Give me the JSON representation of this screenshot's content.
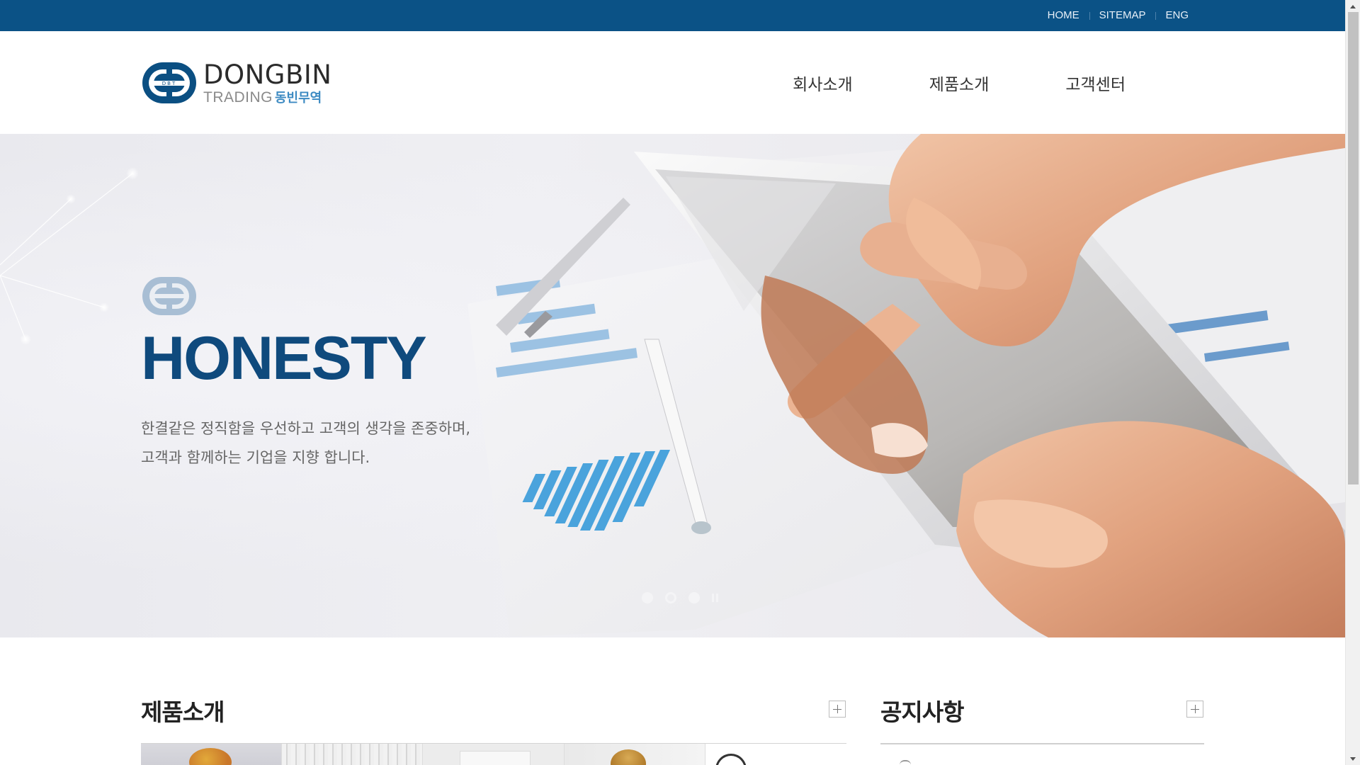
{
  "utility_nav": {
    "items": [
      {
        "label": "HOME"
      },
      {
        "label": "SITEMAP"
      },
      {
        "label": "ENG"
      }
    ]
  },
  "logo": {
    "line1": "DONGBIN",
    "line2_en": "TRADING",
    "line2_ko": "동빈무역",
    "mark_text": "DBT"
  },
  "main_nav": {
    "items": [
      {
        "label": "회사소개"
      },
      {
        "label": "제품소개"
      },
      {
        "label": "고객센터"
      }
    ]
  },
  "hero": {
    "title": "HONESTY",
    "description": [
      "한결같은 정직함을 우선하고 고객의 생각을 존중하며,",
      "고객과 함께하는 기업을 지향 합니다."
    ],
    "slider": {
      "total_slides": 3,
      "active_slide": 2
    }
  },
  "sections": {
    "products": {
      "title": "제품소개"
    },
    "notices": {
      "title": "공지사항"
    }
  },
  "colors": {
    "brand_blue": "#0b5286",
    "headline_blue": "#0f4a7d",
    "logo_accent": "#3c8ac2"
  },
  "icons": {
    "more": "plus-icon",
    "slider_pause": "pause-icon"
  }
}
